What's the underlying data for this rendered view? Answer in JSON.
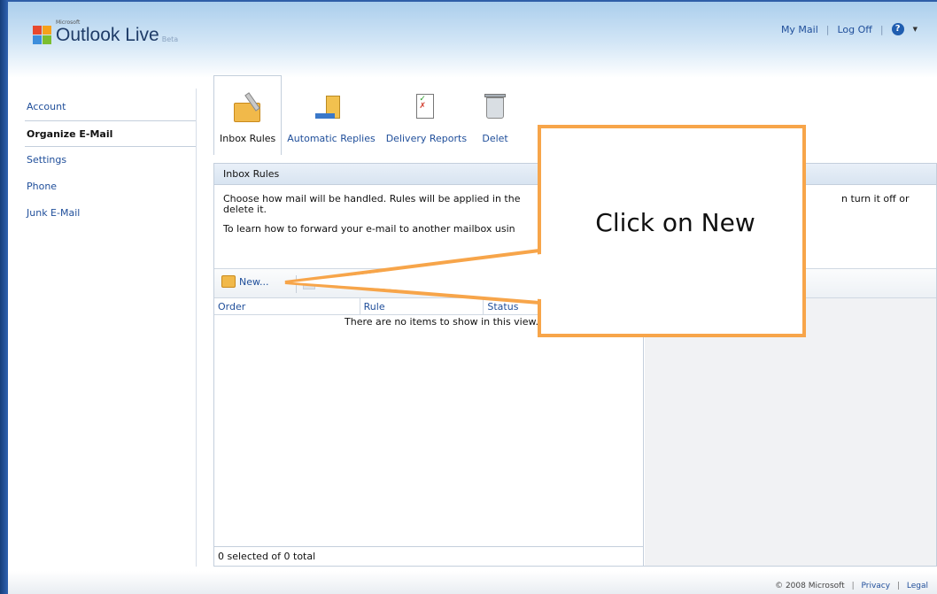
{
  "header": {
    "brand_small": "Microsoft",
    "brand_main": "Outlook Live",
    "brand_beta": "Beta",
    "links": {
      "my_mail": "My Mail",
      "log_off": "Log Off"
    },
    "help_symbol": "?"
  },
  "sidebar": {
    "items": [
      {
        "label": "Account"
      },
      {
        "label": "Organize E-Mail",
        "selected": true
      },
      {
        "label": "Settings"
      },
      {
        "label": "Phone"
      },
      {
        "label": "Junk E-Mail"
      }
    ]
  },
  "tabs": [
    {
      "label": "Inbox Rules",
      "icon": "folder-pen-icon",
      "active": true
    },
    {
      "label": "Automatic Replies",
      "icon": "door-arrow-icon"
    },
    {
      "label": "Delivery Reports",
      "icon": "report-checklist-icon"
    },
    {
      "label": "Delet",
      "icon": "recycle-bin-icon"
    }
  ],
  "panel": {
    "title": "Inbox Rules",
    "description_1": "Choose how mail will be handled. Rules will be applied in the",
    "description_1_right": "n turn it off or",
    "description_1_cont": "delete it.",
    "description_2": "To learn how to forward your e-mail to another mailbox usin",
    "toolbar": {
      "new_label": "New..."
    },
    "columns": [
      "Order",
      "Rule",
      "Status"
    ],
    "empty_message": "There are no items to show in this view.",
    "footer": "0 selected of 0 total"
  },
  "callout": {
    "text": "Click on New",
    "border_color": "#f7a54a"
  },
  "footer": {
    "copyright": "© 2008 Microsoft",
    "privacy": "Privacy",
    "legal": "Legal"
  },
  "colors": {
    "accent": "#1f4e9a",
    "callout": "#f7a54a"
  }
}
